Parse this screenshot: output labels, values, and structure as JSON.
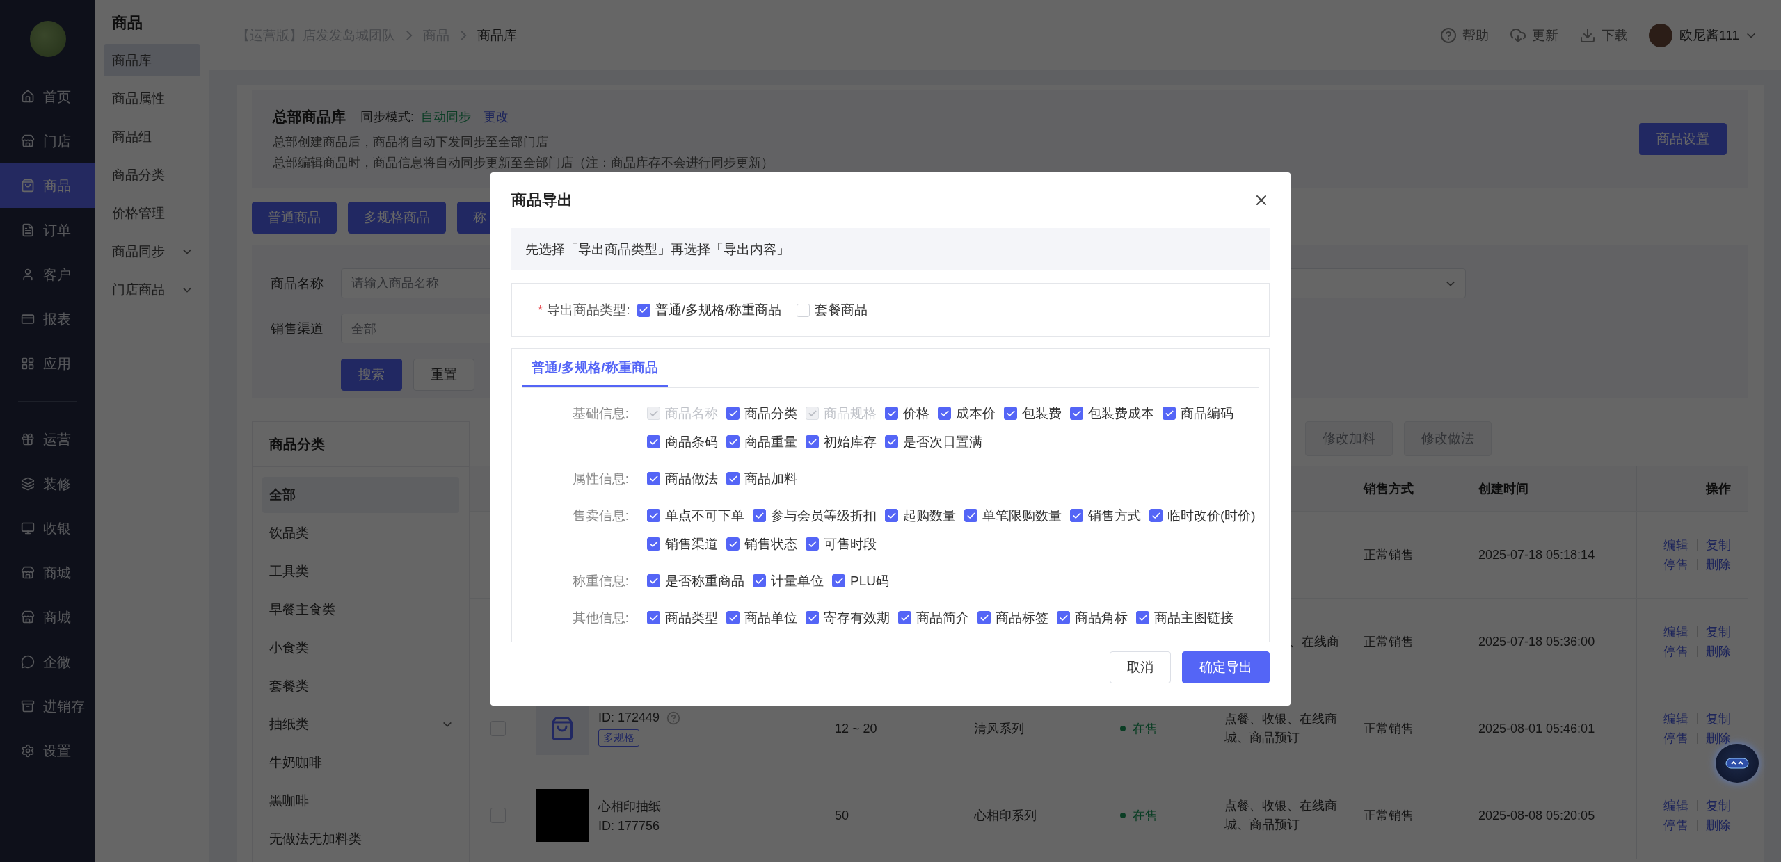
{
  "sidebar": {
    "items": [
      {
        "label": "首页",
        "selected": false
      },
      {
        "label": "门店",
        "selected": false
      },
      {
        "label": "商品",
        "selected": true
      },
      {
        "label": "订单",
        "selected": false
      },
      {
        "label": "客户",
        "selected": false
      },
      {
        "label": "报表",
        "selected": false
      },
      {
        "label": "应用",
        "selected": false
      }
    ],
    "more_items": [
      {
        "label": "运营",
        "selected": false
      },
      {
        "label": "装修",
        "selected": false
      },
      {
        "label": "收银",
        "selected": false
      },
      {
        "label": "商城",
        "selected": false
      },
      {
        "label": "商城",
        "selected": false
      },
      {
        "label": "企微",
        "selected": false
      },
      {
        "label": "进销存",
        "selected": false
      },
      {
        "label": "设置",
        "selected": false
      }
    ]
  },
  "submenu": {
    "title": "商品",
    "items": [
      {
        "label": "商品库",
        "selected": true
      },
      {
        "label": "商品属性",
        "selected": false
      },
      {
        "label": "商品组",
        "selected": false
      },
      {
        "label": "商品分类",
        "selected": false
      },
      {
        "label": "价格管理",
        "selected": false
      },
      {
        "label": "商品同步",
        "selected": false,
        "expanded": false
      },
      {
        "label": "门店商品",
        "selected": false,
        "expanded": false
      }
    ]
  },
  "breadcrumb": [
    "【运营版】店发发岛城团队",
    "商品",
    "商品库"
  ],
  "header_actions": [
    {
      "label": "帮助"
    },
    {
      "label": "更新"
    },
    {
      "label": "下载"
    }
  ],
  "user": {
    "name": "欧尼酱111"
  },
  "library": {
    "title": "总部商品库",
    "sync_label": "同步模式:",
    "sync_value": "自动同步",
    "change_link": "更改",
    "lines": [
      "总部创建商品后，商品将自动下发同步至全部门店",
      "总部编辑商品时，商品信息将自动同步更新至全部门店（注：商品库存不会进行同步更新）"
    ],
    "settings_button": "商品设置"
  },
  "type_buttons": [
    "普通商品",
    "多规格商品",
    "称"
  ],
  "filters": [
    {
      "kind": "input",
      "label": "商品名称",
      "placeholder": "请输入商品名称"
    },
    {
      "kind": "select",
      "label": "销售渠道",
      "value": "全部"
    }
  ],
  "filter_buttons": [
    {
      "kind": "primary",
      "label": "搜索"
    },
    {
      "kind": "default",
      "label": "重置"
    }
  ],
  "categories": {
    "title": "商品分类",
    "items": [
      {
        "label": "全部",
        "selected": true
      },
      {
        "label": "饮品类",
        "selected": false
      },
      {
        "label": "工具类",
        "selected": false
      },
      {
        "label": "早餐主食类",
        "selected": false
      },
      {
        "label": "小食类",
        "selected": false
      },
      {
        "label": "套餐类",
        "selected": false
      },
      {
        "label": "抽纸类",
        "selected": false,
        "expanded": false
      },
      {
        "label": "牛奶咖啡",
        "selected": false
      },
      {
        "label": "黑咖啡",
        "selected": false
      },
      {
        "label": "无做法无加料类",
        "selected": false
      }
    ]
  },
  "table": {
    "toolbar": [
      {
        "label": "修改加料",
        "disabled": true
      },
      {
        "label": "修改做法",
        "disabled": true
      }
    ],
    "columns": [
      "销售方式",
      "创建时间",
      "操作"
    ],
    "rows": [
      {
        "sale_mode": "正常销售",
        "created": "2025-07-18 05:18:14",
        "actions": [
          "编辑",
          "复制",
          "停售",
          "删除"
        ]
      },
      {
        "channels": "、在线商",
        "sale_mode": "正常销售",
        "created": "2025-07-18 05:36:00",
        "actions": [
          "编辑",
          "复制",
          "停售",
          "删除"
        ]
      },
      {
        "selected": false,
        "kind": "icon",
        "id": "ID:  172449",
        "help": true,
        "tag": "多规格",
        "price": "12 ~ 20",
        "series": "清风系列",
        "status": "在售",
        "channels": "点餐、收银、在线商城、商品预订",
        "sale_mode": "正常销售",
        "created": "2025-08-01 05:46:01",
        "actions": [
          "编辑",
          "复制",
          "停售",
          "删除"
        ]
      },
      {
        "selected": false,
        "kind": "photo",
        "name": "心相印抽纸",
        "id": "ID:  177756",
        "price": "50",
        "series": "心相印系列",
        "status": "在售",
        "channels": "点餐、收银、在线商城、商品预订",
        "sale_mode": "正常销售",
        "created": "2025-08-08 05:20:05",
        "actions": [
          "编辑",
          "复制",
          "停售",
          "删除"
        ]
      }
    ]
  },
  "modal": {
    "title": "商品导出",
    "notice": "先选择「导出商品类型」再选择「导出内容」",
    "type_field": {
      "required_mark": "*",
      "label": "导出商品类型:",
      "options": [
        {
          "label": "普通/多规格/称重商品",
          "checked": true
        },
        {
          "label": "套餐商品",
          "checked": false
        }
      ]
    },
    "tabs": [
      {
        "label": "普通/多规格/称重商品",
        "selected": true
      }
    ],
    "groups": [
      {
        "label": "基础信息:",
        "options": [
          {
            "label": "商品名称",
            "checked": true,
            "disabled": true
          },
          {
            "label": "商品分类",
            "checked": true,
            "disabled": false
          },
          {
            "label": "商品规格",
            "checked": true,
            "disabled": true
          },
          {
            "label": "价格",
            "checked": true,
            "disabled": false
          },
          {
            "label": "成本价",
            "checked": true,
            "disabled": false
          },
          {
            "label": "包装费",
            "checked": true,
            "disabled": false
          },
          {
            "label": "包装费成本",
            "checked": true,
            "disabled": false
          },
          {
            "label": "商品编码",
            "checked": true,
            "disabled": false
          },
          {
            "label": "商品条码",
            "checked": true,
            "disabled": false
          },
          {
            "label": "商品重量",
            "checked": true,
            "disabled": false
          },
          {
            "label": "初始库存",
            "checked": true,
            "disabled": false
          },
          {
            "label": "是否次日置满",
            "checked": true,
            "disabled": false
          }
        ]
      },
      {
        "label": "属性信息:",
        "options": [
          {
            "label": "商品做法",
            "checked": true,
            "disabled": false
          },
          {
            "label": "商品加料",
            "checked": true,
            "disabled": false
          }
        ]
      },
      {
        "label": "售卖信息:",
        "options": [
          {
            "label": "单点不可下单",
            "checked": true,
            "disabled": false
          },
          {
            "label": "参与会员等级折扣",
            "checked": true,
            "disabled": false
          },
          {
            "label": "起购数量",
            "checked": true,
            "disabled": false
          },
          {
            "label": "单笔限购数量",
            "checked": true,
            "disabled": false
          },
          {
            "label": "销售方式",
            "checked": true,
            "disabled": false
          },
          {
            "label": "临时改价(时价)",
            "checked": true,
            "disabled": false
          },
          {
            "label": "销售渠道",
            "checked": true,
            "disabled": false
          },
          {
            "label": "销售状态",
            "checked": true,
            "disabled": false
          },
          {
            "label": "可售时段",
            "checked": true,
            "disabled": false
          }
        ]
      },
      {
        "label": "称重信息:",
        "options": [
          {
            "label": "是否称重商品",
            "checked": true,
            "disabled": false
          },
          {
            "label": "计量单位",
            "checked": true,
            "disabled": false
          },
          {
            "label": "PLU码",
            "checked": true,
            "disabled": false
          }
        ]
      },
      {
        "label": "其他信息:",
        "options": [
          {
            "label": "商品类型",
            "checked": true,
            "disabled": false
          },
          {
            "label": "商品单位",
            "checked": true,
            "disabled": false
          },
          {
            "label": "寄存有效期",
            "checked": true,
            "disabled": false
          },
          {
            "label": "商品简介",
            "checked": true,
            "disabled": false
          },
          {
            "label": "商品标签",
            "checked": true,
            "disabled": false
          },
          {
            "label": "商品角标",
            "checked": true,
            "disabled": false
          },
          {
            "label": "商品主图链接",
            "checked": true,
            "disabled": false
          }
        ]
      }
    ],
    "buttons": [
      {
        "kind": "default",
        "label": "取消"
      },
      {
        "kind": "primary",
        "label": "确定导出"
      }
    ]
  }
}
